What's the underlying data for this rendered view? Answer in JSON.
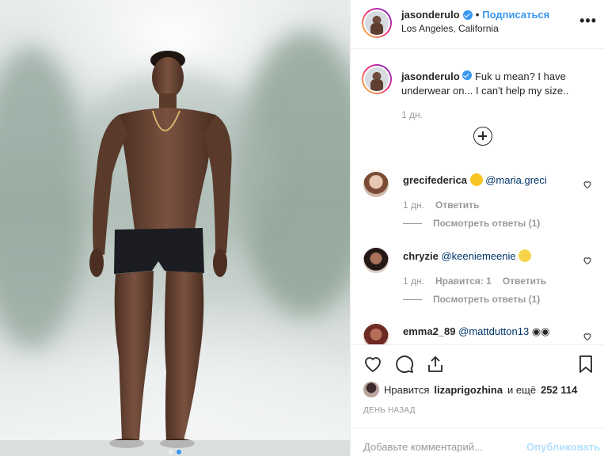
{
  "post": {
    "username": "jasonderulo",
    "separator": "•",
    "follow_label": "Подписаться",
    "location": "Los Angeles, California",
    "more_label": "•••"
  },
  "caption": {
    "username": "jasonderulo",
    "text": "Fuk u mean? I have underwear on... I can't help my size..",
    "time": "1 дн."
  },
  "comments": [
    {
      "username": "grecifederica",
      "emoji": "grinning-sweat-emoji",
      "mention": "@maria.greci",
      "time": "1 дн.",
      "likes": "",
      "reply_label": "Ответить",
      "view_replies": "Посмотреть ответы (1)"
    },
    {
      "username": "chryzie",
      "mention": "@keeniemeenie",
      "emoji": "scream-emoji",
      "time": "1 дн.",
      "likes": "Нравится: 1",
      "reply_label": "Ответить",
      "view_replies": "Посмотреть ответы (1)"
    },
    {
      "username": "emma2_89",
      "mention": "@mattdutton13",
      "emoji": "eyes-emoji"
    }
  ],
  "likes": {
    "prefix": "Нравится",
    "user": "lizaprigozhina",
    "middle": "и ещё",
    "count": "252 114"
  },
  "date": "ДЕНЬ НАЗАД",
  "add_comment": {
    "placeholder": "Добавьте комментарий...",
    "post_label": "Опубликовать"
  },
  "carousel": {
    "total": 2,
    "active": 2
  },
  "colors": {
    "accent": "#3897f0",
    "mention": "#003569",
    "muted": "#999999",
    "post_disabled": "#b2dffc"
  }
}
